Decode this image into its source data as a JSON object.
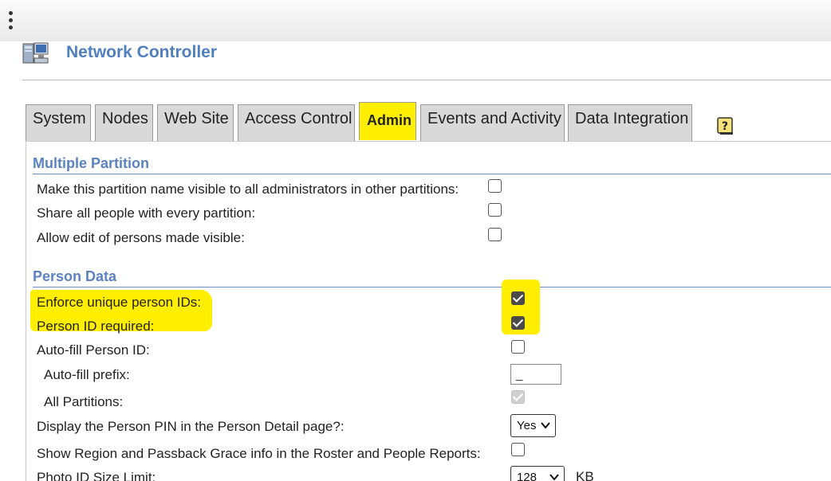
{
  "app": {
    "title": "Network Controller"
  },
  "tabs": [
    {
      "label": "System"
    },
    {
      "label": "Nodes"
    },
    {
      "label": "Web Site"
    },
    {
      "label": "Access Control"
    },
    {
      "label": "Admin",
      "active": true
    },
    {
      "label": "Events and Activity"
    },
    {
      "label": "Data Integration"
    }
  ],
  "help_icon": "help-icon",
  "multiple_partition": {
    "heading": "Multiple Partition",
    "rows": [
      {
        "label": "Make this partition name visible to all administrators in other partitions:",
        "checked": false
      },
      {
        "label": "Share all people with every partition:",
        "checked": false
      },
      {
        "label": "Allow edit of persons made visible:",
        "checked": false
      }
    ]
  },
  "person_data": {
    "heading": "Person Data",
    "enforce_unique": {
      "label": "Enforce unique person IDs:",
      "checked": true
    },
    "id_required": {
      "label": "Person ID required:",
      "checked": true
    },
    "auto_fill": {
      "label": "Auto-fill Person ID:",
      "checked": false
    },
    "auto_fill_prefix": {
      "label": "Auto-fill prefix:",
      "value": "_"
    },
    "all_partitions": {
      "label": "All Partitions:",
      "checked": true,
      "disabled": true
    },
    "display_pin": {
      "label": "Display the Person PIN in the Person Detail page?:",
      "value": "Yes"
    },
    "show_region": {
      "label": "Show Region and Passback Grace info in the Roster and People Reports:",
      "checked": false
    },
    "photo_limit": {
      "label": "Photo ID Size Limit:",
      "value": "128",
      "unit": "KB"
    }
  },
  "colors": {
    "highlight": "#ffee00",
    "section_heading": "#5b83c2",
    "title": "#4f7fbf"
  }
}
